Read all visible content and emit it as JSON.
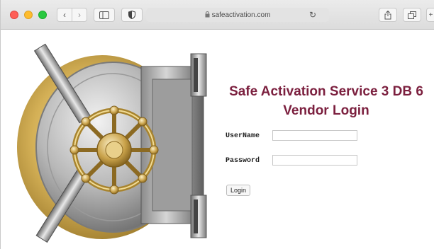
{
  "browser": {
    "url": "safeactivation.com",
    "back_glyph": "‹",
    "forward_glyph": "›",
    "reload_glyph": "↻",
    "colors": {
      "close": "#fe5f57",
      "minimize": "#febc2e",
      "zoom": "#28c840"
    },
    "icons": [
      "back-icon",
      "forward-icon",
      "sidebar-icon",
      "shield-icon",
      "lock-icon",
      "reload-icon",
      "share-icon",
      "tabs-icon",
      "plus-icon"
    ]
  },
  "page": {
    "title_line1": "Safe Activation Service 3 DB 6",
    "title_line2": "Vendor Login",
    "title_color": "#7b1f3e",
    "username_label": "UserName",
    "username_value": "",
    "password_label": "Password",
    "password_value": "",
    "login_label": "Login",
    "image": "bank-vault-door"
  }
}
